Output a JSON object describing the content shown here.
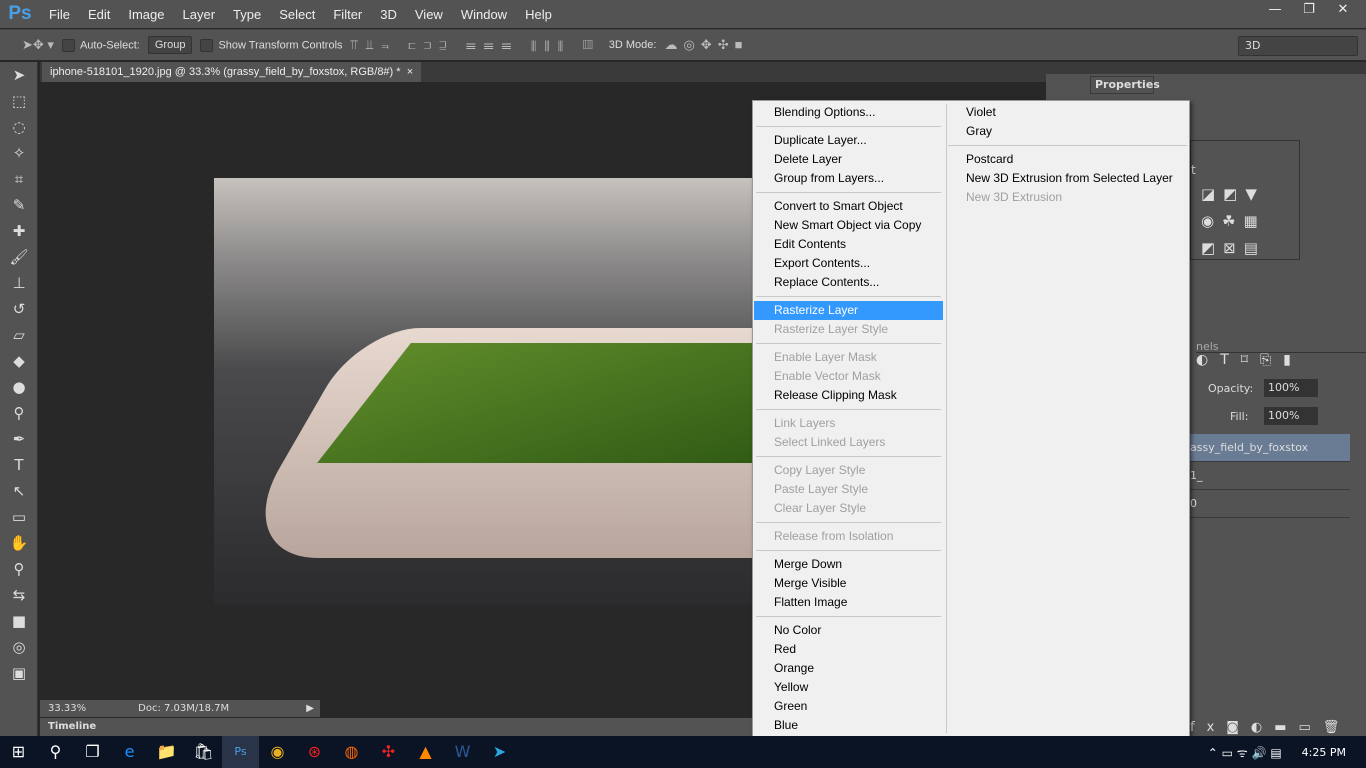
{
  "app": {
    "logo": "Ps",
    "menus": [
      "File",
      "Edit",
      "Image",
      "Layer",
      "Type",
      "Select",
      "Filter",
      "3D",
      "View",
      "Window",
      "Help"
    ],
    "window_controls": [
      "—",
      "❐",
      "✕"
    ]
  },
  "options": {
    "auto_select_label": "Auto-Select:",
    "auto_select_checked": false,
    "group_value": "Group",
    "show_transform_label": "Show Transform Controls",
    "show_transform_checked": false,
    "mode_label": "3D Mode:",
    "workspace_value": "3D"
  },
  "document": {
    "tab_title": "iphone-518101_1920.jpg @ 33.3% (grassy_field_by_foxstox, RGB/8#) *",
    "close": "×",
    "zoom": "33.33%",
    "doc_size": "Doc: 7.03M/18.7M"
  },
  "timeline": {
    "label": "Timeline"
  },
  "panels": {
    "properties_tab": "Properties",
    "channels_tab_partial": "nels",
    "adjustments_partial": "t",
    "opacity_label": "Opacity:",
    "opacity_value": "100%",
    "fill_label": "Fill:",
    "fill_value": "100%",
    "layers": [
      "assy_field_by_foxstox",
      "1_",
      "0"
    ],
    "selected_layer_index": 0
  },
  "context_menu": {
    "left": [
      [
        {
          "label": "Blending Options...",
          "enabled": true
        }
      ],
      [
        {
          "label": "Duplicate Layer...",
          "enabled": true
        },
        {
          "label": "Delete Layer",
          "enabled": true
        },
        {
          "label": "Group from Layers...",
          "enabled": true
        }
      ],
      [
        {
          "label": "Convert to Smart Object",
          "enabled": true
        },
        {
          "label": "New Smart Object via Copy",
          "enabled": true
        },
        {
          "label": "Edit Contents",
          "enabled": true
        },
        {
          "label": "Export Contents...",
          "enabled": true
        },
        {
          "label": "Replace Contents...",
          "enabled": true
        }
      ],
      [
        {
          "label": "Rasterize Layer",
          "enabled": true,
          "highlighted": true
        },
        {
          "label": "Rasterize Layer Style",
          "enabled": false
        }
      ],
      [
        {
          "label": "Enable Layer Mask",
          "enabled": false
        },
        {
          "label": "Enable Vector Mask",
          "enabled": false
        },
        {
          "label": "Release Clipping Mask",
          "enabled": true
        }
      ],
      [
        {
          "label": "Link Layers",
          "enabled": false
        },
        {
          "label": "Select Linked Layers",
          "enabled": false
        }
      ],
      [
        {
          "label": "Copy Layer Style",
          "enabled": false
        },
        {
          "label": "Paste Layer Style",
          "enabled": false
        },
        {
          "label": "Clear Layer Style",
          "enabled": false
        }
      ],
      [
        {
          "label": "Release from Isolation",
          "enabled": false
        }
      ],
      [
        {
          "label": "Merge Down",
          "enabled": true
        },
        {
          "label": "Merge Visible",
          "enabled": true
        },
        {
          "label": "Flatten Image",
          "enabled": true
        }
      ],
      [
        {
          "label": "No Color",
          "enabled": true
        },
        {
          "label": "Red",
          "enabled": true
        },
        {
          "label": "Orange",
          "enabled": true
        },
        {
          "label": "Yellow",
          "enabled": true
        },
        {
          "label": "Green",
          "enabled": true
        },
        {
          "label": "Blue",
          "enabled": true
        }
      ]
    ],
    "right": [
      [
        {
          "label": "Violet",
          "enabled": true
        },
        {
          "label": "Gray",
          "enabled": true
        }
      ],
      [
        {
          "label": "Postcard",
          "enabled": true
        },
        {
          "label": "New 3D Extrusion from Selected Layer",
          "enabled": true
        },
        {
          "label": "New 3D Extrusion",
          "enabled": false
        }
      ]
    ]
  },
  "taskbar": {
    "time": "4:25 PM",
    "apps": [
      "start-icon",
      "search-icon",
      "task-view-icon",
      "edge-icon",
      "file-explorer-icon",
      "store-icon",
      "photoshop-icon",
      "chrome-icon",
      "app-icon",
      "firefox-icon",
      "app2-icon",
      "vlc-icon",
      "word-icon",
      "telegram-icon"
    ]
  },
  "colors": {
    "highlight": "#3399ff",
    "selected_layer": "#6a7b94"
  }
}
